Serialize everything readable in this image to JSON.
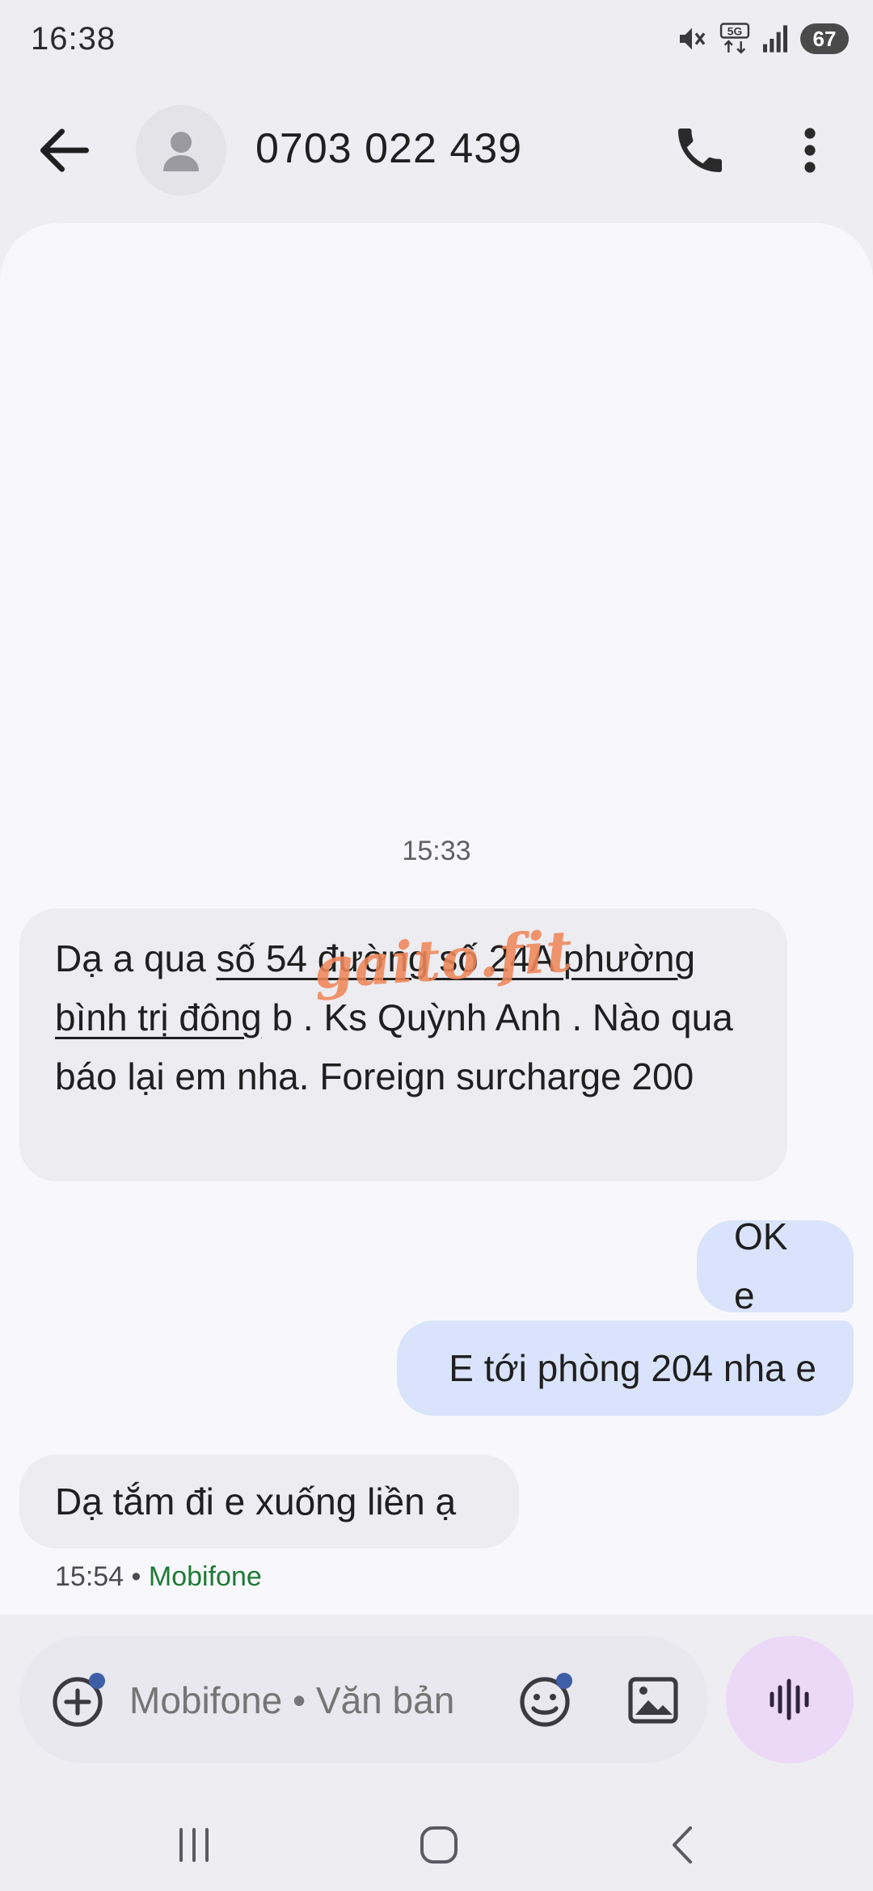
{
  "status_bar": {
    "time": "16:38",
    "battery": "67",
    "network_label": "5G",
    "icons": [
      "mute-icon",
      "5g-data-icon",
      "signal-icon",
      "battery-icon"
    ]
  },
  "header": {
    "contact": "0703 022 439",
    "icons": [
      "back-arrow-icon",
      "person-icon",
      "phone-icon",
      "more-vert-icon"
    ]
  },
  "conversation": {
    "divider_time": "15:33",
    "messages": [
      {
        "direction": "incoming",
        "parts": {
          "pre": "Dạ a qua ",
          "link": "số 54 đường số 24A phường bình trị đông",
          "post": " b . Ks Quỳnh Anh . Nào qua báo lại em nha. Foreign surcharge 200"
        }
      },
      {
        "direction": "outgoing",
        "text": "OK e"
      },
      {
        "direction": "outgoing",
        "text": "E tới phòng 204 nha e"
      },
      {
        "direction": "incoming",
        "text": "Dạ tắm đi e xuống liền ạ"
      }
    ],
    "last_meta": {
      "time": "15:54",
      "separator": "•",
      "carrier": "Mobifone"
    },
    "watermark": "gaito.fit"
  },
  "composer": {
    "placeholder": "Mobifone • Văn bản",
    "icons": [
      "add-icon",
      "emoji-icon",
      "gallery-icon",
      "voice-wave-icon"
    ]
  },
  "nav_bar": {
    "icons": [
      "recents-icon",
      "home-icon",
      "nav-back-icon"
    ]
  },
  "colors": {
    "background": "#eeedf2",
    "panel": "#f8f8fc",
    "incoming_bubble": "#ececf1",
    "outgoing_bubble": "#d9e3fb",
    "carrier_green": "#1e7a34",
    "voice_button": "#ecd9f7",
    "watermark": "#f0875a"
  }
}
